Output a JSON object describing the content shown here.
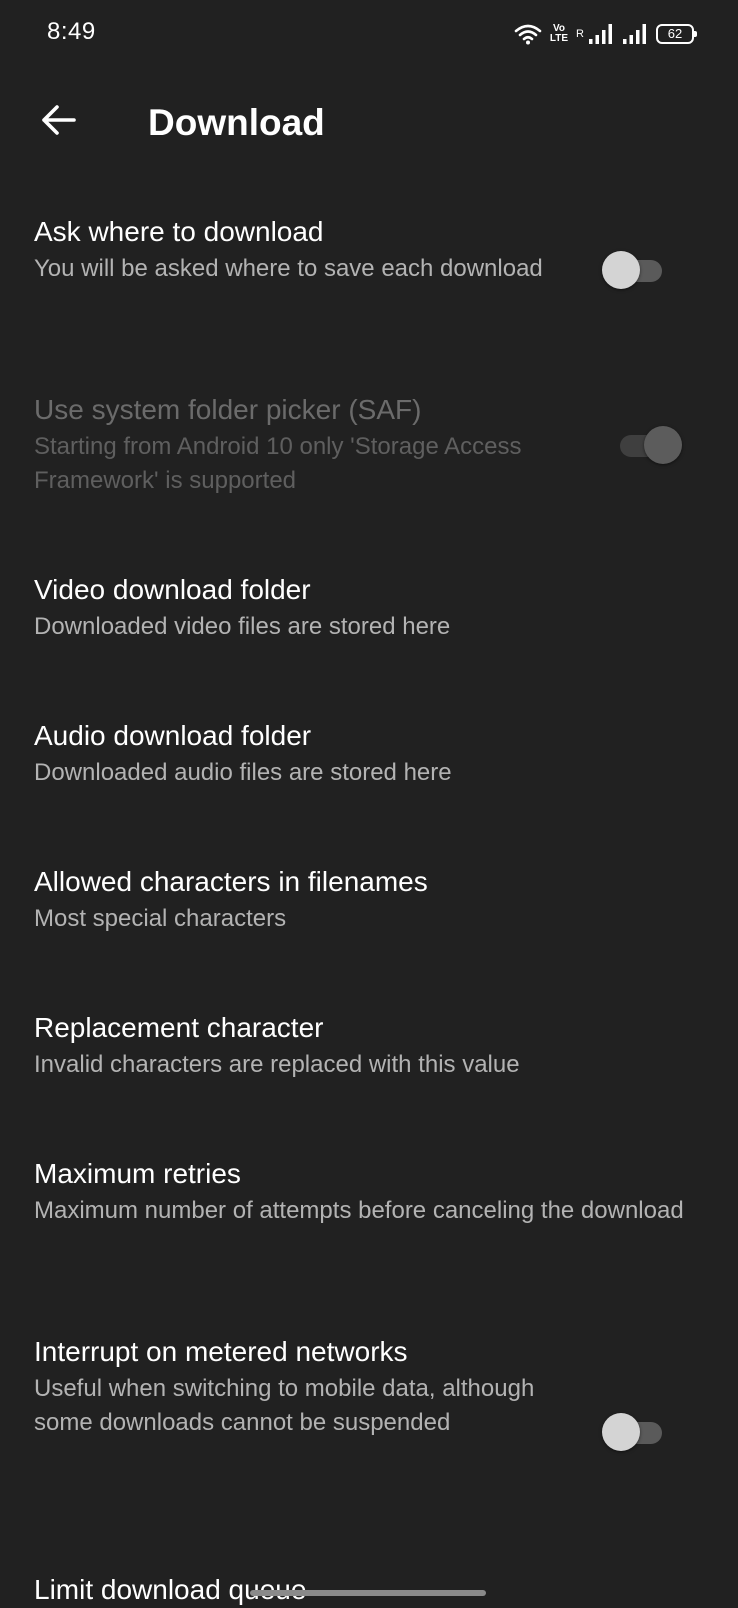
{
  "status_bar": {
    "time": "8:49",
    "volte_line1": "Vo",
    "volte_line2": "LTE",
    "roaming": "R",
    "battery": "62",
    "icons": [
      "wifi-icon",
      "volte-icon",
      "signal-icon",
      "signal-icon",
      "battery-icon"
    ]
  },
  "app_bar": {
    "back_icon": "arrow-left-icon",
    "title": "Download"
  },
  "preferences": [
    {
      "title": "Ask where to download",
      "summary": "You will be asked where to save each download",
      "switch": "off",
      "enabled": true
    },
    {
      "title": "Use system folder picker (SAF)",
      "summary": "Starting from Android 10 only 'Storage Access Framework' is supported",
      "switch": "on",
      "enabled": false
    },
    {
      "title": "Video download folder",
      "summary": "Downloaded video files are stored here"
    },
    {
      "title": "Audio download folder",
      "summary": "Downloaded audio files are stored here"
    },
    {
      "title": "Allowed characters in filenames",
      "summary": "Most special characters"
    },
    {
      "title": "Replacement character",
      "summary": "Invalid characters are replaced with this value"
    },
    {
      "title": "Maximum retries",
      "summary": "Maximum number of attempts before canceling the download"
    },
    {
      "title": "Interrupt on metered networks",
      "summary": "Useful when switching to mobile data, although some downloads cannot be suspended",
      "switch": "off",
      "enabled": true
    },
    {
      "title": "Limit download queue"
    }
  ],
  "colors": {
    "background": "#212121",
    "title_text": "#ffffff",
    "summary_text": "#b3b3b3",
    "disabled_text": "#6b6b6b"
  }
}
